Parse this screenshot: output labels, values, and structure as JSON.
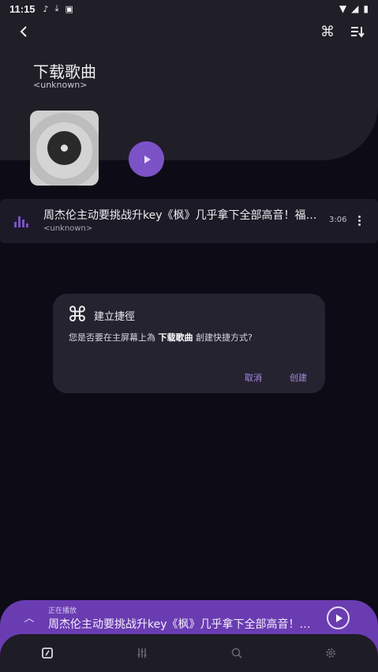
{
  "status_bar": {
    "time": "11:15",
    "icons": [
      "music-note-icon",
      "download-icon",
      "notification-icon",
      "wifi-icon",
      "signal-icon",
      "battery-icon"
    ]
  },
  "toolbar": {
    "back_icon": "back-arrow-icon",
    "shortcut_icon": "command-icon",
    "sort_icon": "sort-icon"
  },
  "playlist": {
    "title": "下载歌曲",
    "subtitle": "<unknown>"
  },
  "songs": [
    {
      "title": "周杰伦主动要挑战升key《枫》几乎拿下全部高音！福州...",
      "artist": "<unknown>",
      "duration": "3:06"
    }
  ],
  "dialog": {
    "title": "建立捷徑",
    "message_prefix": "您是否要在主屏幕上為 ",
    "message_name": "下载歌曲",
    "message_suffix": " 創建快捷方式?",
    "cancel_label": "取消",
    "create_label": "创建"
  },
  "mini_player": {
    "label": "正在播放",
    "title": "周杰伦主动要挑战升key《枫》几乎拿下全部高音！福州..."
  },
  "bottom_nav": {
    "items": [
      "library-icon",
      "equalizer-icon",
      "search-icon",
      "settings-icon"
    ]
  },
  "colors": {
    "accent": "#7c52c7",
    "background": "#0d0b16",
    "panel": "#201e27",
    "dialog": "#262331",
    "mini_player": "#6a3cb1"
  }
}
